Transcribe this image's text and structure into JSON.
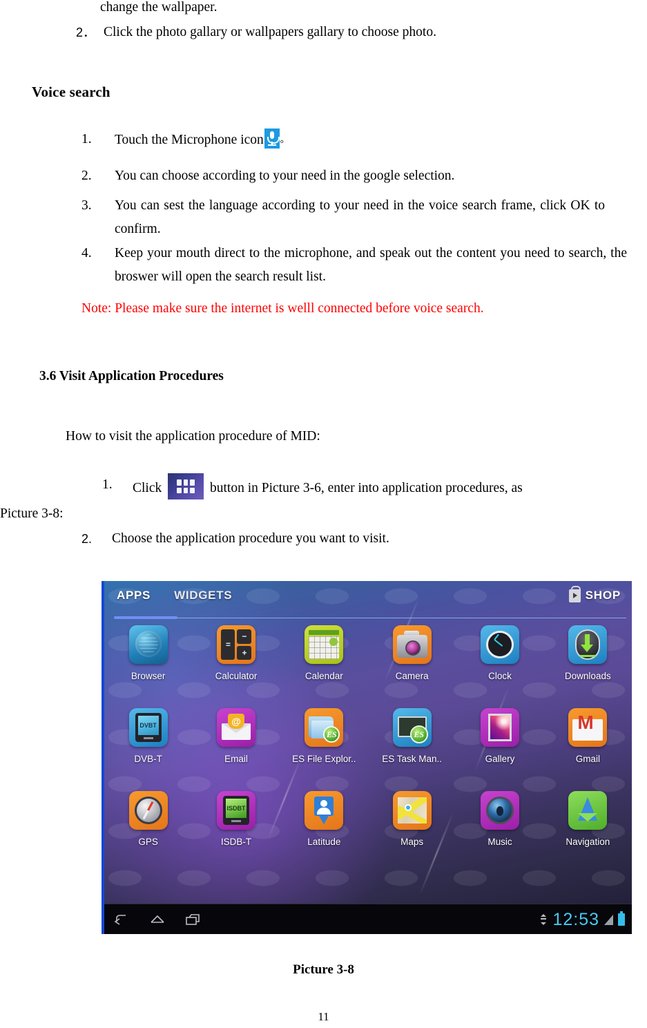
{
  "document": {
    "continuation_line": "change the wallpaper.",
    "wallpaper_step": {
      "marker": "2．",
      "text": "Click the photo gallary or wallpapers gallary to choose photo."
    },
    "voice_search": {
      "heading": "Voice search",
      "steps": [
        {
          "marker": "1.",
          "text_before_icon": "Touch the Microphone icon",
          "icon": "microphone-icon",
          "text_after_icon": "。"
        },
        {
          "marker": "2.",
          "text": "You can choose according to your need in the google selection."
        },
        {
          "marker": "3.",
          "text": "You can sest the language according to your need in the voice search frame, click OK to confirm."
        },
        {
          "marker": "4.",
          "text": "Keep your mouth direct to the microphone, and speak out the content you need to search, the broswer will open the search result list."
        }
      ],
      "note": "Note: Please make sure the internet is welll connected before voice search.",
      "note_color": "#ff0000"
    },
    "section": {
      "heading": "3.6 Visit Application Procedures",
      "intro": "How to visit the application procedure of MID:",
      "steps": [
        {
          "marker": "1.",
          "text_before_icon": "Click",
          "icon": "apps-grid-icon",
          "text_after_icon": "button in Picture 3-6, enter into application procedures, as",
          "overflow_text": "Picture 3-8:"
        },
        {
          "marker": "2.",
          "text": "Choose the application procedure you want to visit."
        }
      ]
    },
    "figure_caption": "Picture 3-8",
    "page_number": "11"
  },
  "screenshot": {
    "tabbar": {
      "tabs": [
        {
          "label": "APPS",
          "active": true
        },
        {
          "label": "WIDGETS",
          "active": false
        }
      ],
      "shop": {
        "label": "SHOP",
        "icon": "shopping-bag-icon"
      },
      "active_underline_color": "#6f8ff4"
    },
    "apps": [
      {
        "name": "Browser",
        "tile": "t-browser"
      },
      {
        "name": "Calculator",
        "tile": "t-calc"
      },
      {
        "name": "Calendar",
        "tile": "t-cal"
      },
      {
        "name": "Camera",
        "tile": "t-cam"
      },
      {
        "name": "Clock",
        "tile": "t-clock"
      },
      {
        "name": "Downloads",
        "tile": "t-dl"
      },
      {
        "name": "DVB-T",
        "tile": "t-dvb",
        "screen_text": "DVBT"
      },
      {
        "name": "Email",
        "tile": "t-email",
        "glyph": "@"
      },
      {
        "name": "ES File Explor..",
        "tile": "t-esfile",
        "glyph": "ES"
      },
      {
        "name": "ES Task Man..",
        "tile": "t-estask",
        "glyph": "ES"
      },
      {
        "name": "Gallery",
        "tile": "t-gal"
      },
      {
        "name": "Gmail",
        "tile": "t-gmail",
        "glyph": "M"
      },
      {
        "name": "GPS",
        "tile": "t-gps"
      },
      {
        "name": "ISDB-T",
        "tile": "t-isdb",
        "screen_text": "ISDBT"
      },
      {
        "name": "Latitude",
        "tile": "t-lat"
      },
      {
        "name": "Maps",
        "tile": "t-maps"
      },
      {
        "name": "Music",
        "tile": "t-music"
      },
      {
        "name": "Navigation",
        "tile": "t-nav"
      }
    ],
    "systembar": {
      "nav": [
        {
          "icon": "back-icon"
        },
        {
          "icon": "home-icon"
        },
        {
          "icon": "recents-icon"
        }
      ],
      "status": {
        "usb_icon": "usb-transfer-icon",
        "time": "12:53",
        "signal_icon": "signal-icon",
        "battery_icon": "battery-icon",
        "time_color": "#49c8f0"
      }
    }
  }
}
